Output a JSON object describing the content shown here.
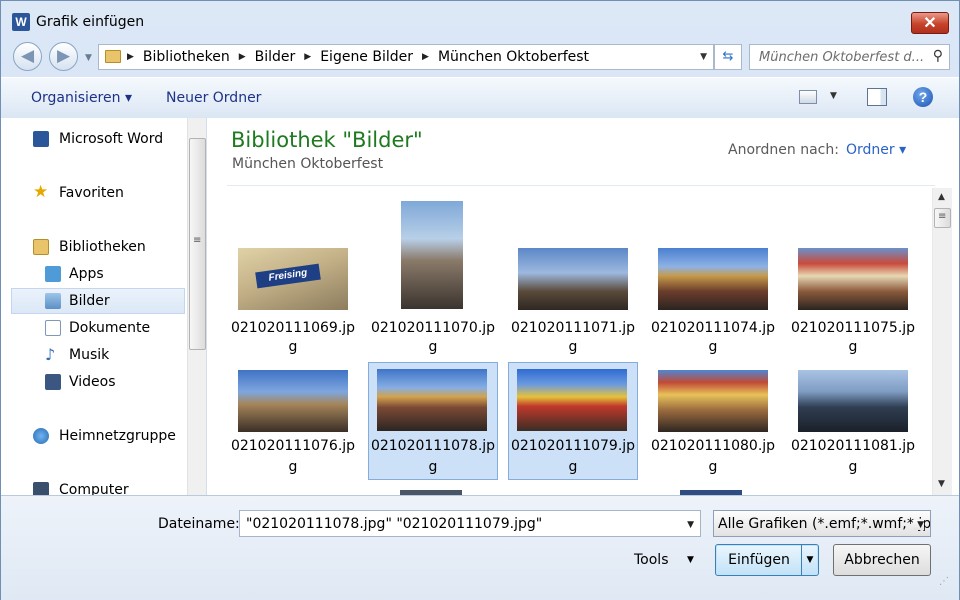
{
  "window": {
    "title": "Grafik einfügen",
    "app_icon": "W",
    "close_label": "✕"
  },
  "nav": {
    "breadcrumbs": [
      "Bibliotheken",
      "Bilder",
      "Eigene Bilder",
      "München Oktoberfest"
    ],
    "search_placeholder": "München Oktoberfest d..."
  },
  "toolbar": {
    "organize_label": "Organisieren ▾",
    "new_folder_label": "Neuer Ordner",
    "help_label": "?"
  },
  "sidebar": {
    "items": [
      {
        "label": "Microsoft Word",
        "icon": "word-icon"
      },
      {
        "label": "Favoriten",
        "icon": "star-icon"
      },
      {
        "label": "Bibliotheken",
        "icon": "libraries-icon"
      },
      {
        "label": "Apps",
        "icon": "apps-icon"
      },
      {
        "label": "Bilder",
        "icon": "pictures-icon",
        "selected": true
      },
      {
        "label": "Dokumente",
        "icon": "documents-icon"
      },
      {
        "label": "Musik",
        "icon": "music-icon"
      },
      {
        "label": "Videos",
        "icon": "videos-icon"
      },
      {
        "label": "Heimnetzgruppe",
        "icon": "homegroup-icon"
      },
      {
        "label": "Computer",
        "icon": "computer-icon"
      }
    ]
  },
  "content": {
    "title": "Bibliothek \"Bilder\"",
    "subtitle": "München Oktoberfest",
    "arrange_label": "Anordnen nach:",
    "arrange_value": "Ordner ▾",
    "files": [
      {
        "name_line1": "021020111069.jp",
        "name_line2": "g",
        "selected": false
      },
      {
        "name_line1": "021020111070.jp",
        "name_line2": "g",
        "selected": false
      },
      {
        "name_line1": "021020111071.jp",
        "name_line2": "g",
        "selected": false
      },
      {
        "name_line1": "021020111074.jp",
        "name_line2": "g",
        "selected": false
      },
      {
        "name_line1": "021020111075.jp",
        "name_line2": "g",
        "selected": false
      },
      {
        "name_line1": "021020111076.jp",
        "name_line2": "g",
        "selected": false
      },
      {
        "name_line1": "021020111078.jp",
        "name_line2": "g",
        "selected": true
      },
      {
        "name_line1": "021020111079.jp",
        "name_line2": "g",
        "selected": true
      },
      {
        "name_line1": "021020111080.jp",
        "name_line2": "g",
        "selected": false
      },
      {
        "name_line1": "021020111081.jp",
        "name_line2": "g",
        "selected": false
      }
    ]
  },
  "footer": {
    "filename_label": "Dateiname:",
    "filename_value": "\"021020111078.jpg\" \"021020111079.jpg\"",
    "filetype_value": "Alle Grafiken (*.emf;*.wmf;*.jp",
    "tools_label": "Tools",
    "insert_label": "Einfügen",
    "cancel_label": "Abbrechen"
  }
}
